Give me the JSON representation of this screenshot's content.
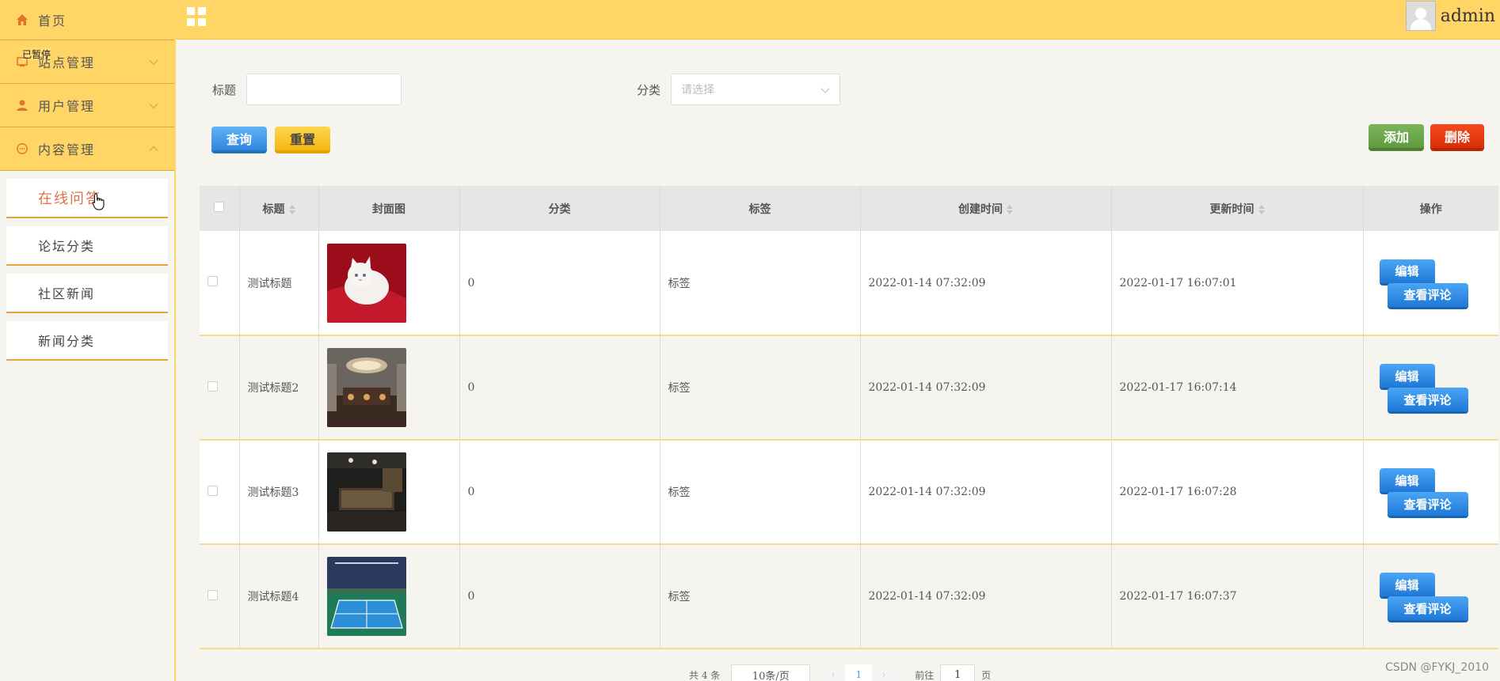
{
  "sidebar": {
    "menu": [
      {
        "label": "首页",
        "icon": "home-icon"
      },
      {
        "label": "站点管理",
        "icon": "site-icon"
      },
      {
        "label": "用户管理",
        "icon": "user-icon"
      },
      {
        "label": "内容管理",
        "icon": "chat-icon"
      }
    ],
    "overlay_text": "已暂停",
    "submenu": [
      "在线问答",
      "论坛分类",
      "社区新闻",
      "新闻分类"
    ]
  },
  "header": {
    "username": "admin"
  },
  "search": {
    "title_label": "标题",
    "category_label": "分类",
    "category_placeholder": "请选择",
    "query_label": "查询",
    "reset_label": "重置"
  },
  "actions": {
    "add_label": "添加",
    "delete_label": "删除"
  },
  "table": {
    "headers": [
      "标题",
      "封面图",
      "分类",
      "标签",
      "创建时间",
      "更新时间",
      "操作"
    ],
    "rows": [
      {
        "title": "测试标题",
        "category": "0",
        "tag": "标签",
        "created": "2022-01-14 07:32:09",
        "updated": "2022-01-17 16:07:01"
      },
      {
        "title": "测试标题2",
        "category": "0",
        "tag": "标签",
        "created": "2022-01-14 07:32:09",
        "updated": "2022-01-17 16:07:14"
      },
      {
        "title": "测试标题3",
        "category": "0",
        "tag": "标签",
        "created": "2022-01-14 07:32:09",
        "updated": "2022-01-17 16:07:28"
      },
      {
        "title": "测试标题4",
        "category": "0",
        "tag": "标签",
        "created": "2022-01-14 07:32:09",
        "updated": "2022-01-17 16:07:37"
      }
    ],
    "edit_label": "编辑",
    "comments_label": "查看评论"
  },
  "pagination": {
    "total": "共 4 条",
    "page_size": "10条/页",
    "current": "1",
    "goto_label": "前往",
    "goto_value": "1",
    "page_suffix": "页"
  },
  "watermark": "CSDN @FYKJ_2010"
}
